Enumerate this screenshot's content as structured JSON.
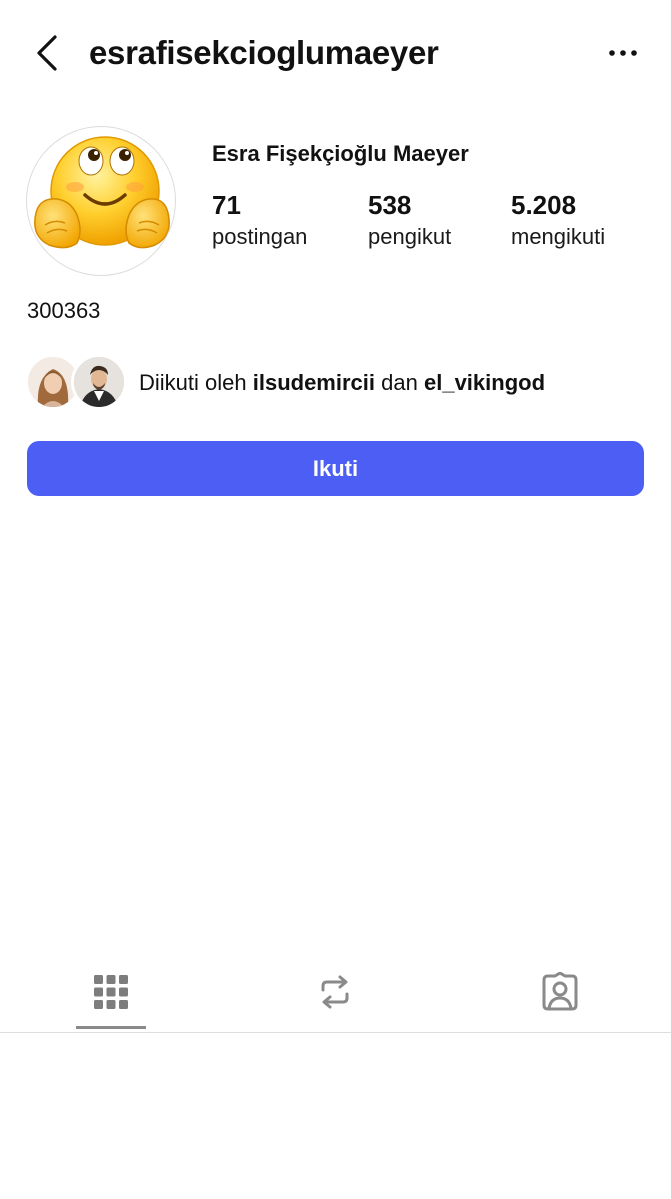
{
  "header": {
    "username": "esrafisekcioglumaeyer",
    "back_icon": "chevron-left-icon",
    "more_icon": "more-horizontal-icon"
  },
  "profile": {
    "display_name": "Esra Fişekçioğlu Maeyer",
    "avatar_icon": "smiley-emoji-icon",
    "bio": "300363"
  },
  "stats": [
    {
      "value": "71",
      "label": "postingan"
    },
    {
      "value": "538",
      "label": "pengikut"
    },
    {
      "value": "5.208",
      "label": "mengikuti"
    }
  ],
  "followed_by": {
    "prefix": "Diikuti oleh",
    "user1": "ilsudemircii",
    "connector": "dan",
    "user2": "el_vikingod"
  },
  "follow_button": {
    "label": "Ikuti",
    "color": "#4c5ef3"
  },
  "tabs": [
    {
      "icon": "grid-icon",
      "active": true
    },
    {
      "icon": "repost-icon",
      "active": false
    },
    {
      "icon": "tagged-person-icon",
      "active": false
    }
  ]
}
